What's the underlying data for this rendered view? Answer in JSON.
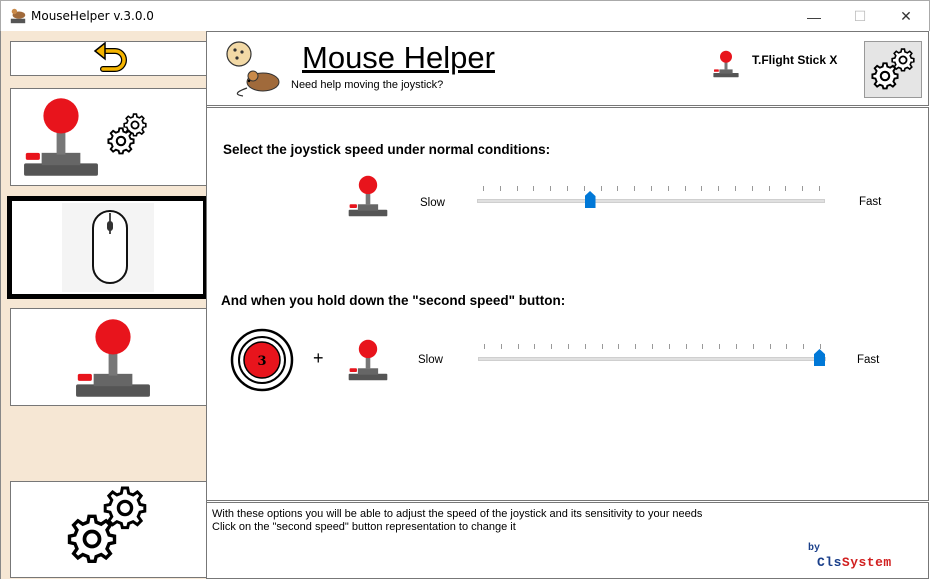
{
  "window": {
    "title": "MouseHelper v.3.0.0",
    "minimize": "—",
    "maximize": "☐",
    "close": "✕"
  },
  "header": {
    "app_name": "Mouse Helper",
    "subtitle": "Need help moving the joystick?",
    "device_name": "T.Flight Stick X"
  },
  "main": {
    "normal_label": "Select the joystick speed under normal conditions:",
    "second_label": "And when you hold down the \"second speed\" button:",
    "slow": "Slow",
    "fast": "Fast",
    "plus": "+",
    "button_number": "3",
    "normal_speed_fraction": 0.32,
    "second_speed_fraction": 1.0
  },
  "footer": {
    "info_line1": "With these options you will be able to adjust the speed of the joystick and its sensitivity to your needs",
    "info_line2": "Click on the \"second speed\" button representation to change it",
    "by": "by",
    "brand_part1": "Cls",
    "brand_part2": "System"
  },
  "sidebar": {
    "icons": [
      "back-arrow-icon",
      "joystick-settings-icon",
      "mouse-icon",
      "joystick-icon",
      "gears-icon"
    ]
  },
  "colors": {
    "sidebar_bg": "#f6e7d4",
    "slider_thumb": "#0078d7",
    "joystick_red": "#e8141c",
    "joystick_base": "#5a5a5a",
    "back_arrow": "#f4b400"
  }
}
